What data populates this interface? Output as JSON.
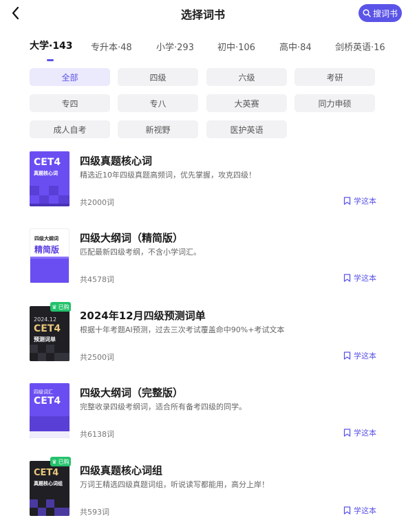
{
  "header": {
    "title": "选择词书",
    "search_label": "搜词书"
  },
  "tabs": [
    {
      "label": "大学·143",
      "active": true
    },
    {
      "label": "专升本·48",
      "active": false
    },
    {
      "label": "小学·293",
      "active": false
    },
    {
      "label": "初中·106",
      "active": false
    },
    {
      "label": "高中·84",
      "active": false
    },
    {
      "label": "剑桥英语·16",
      "active": false
    }
  ],
  "filters": [
    {
      "label": "全部",
      "active": true
    },
    {
      "label": "四级",
      "active": false
    },
    {
      "label": "六级",
      "active": false
    },
    {
      "label": "考研",
      "active": false
    },
    {
      "label": "专四",
      "active": false
    },
    {
      "label": "专八",
      "active": false
    },
    {
      "label": "大英赛",
      "active": false
    },
    {
      "label": "同力申硕",
      "active": false
    },
    {
      "label": "成人自考",
      "active": false
    },
    {
      "label": "新视野",
      "active": false
    },
    {
      "label": "医护英语",
      "active": false
    }
  ],
  "books": [
    {
      "title": "四级真题核心词",
      "desc": "精选近10年四级真题高频词，优先掌握，攻克四级！",
      "count": "共2000词",
      "action": "学这本",
      "bought": false,
      "cover": {
        "line1": "CET4",
        "line2": "真题核心词",
        "bg": "#6b4ef2",
        "style": "purple"
      }
    },
    {
      "title": "四级大纲词（精简版）",
      "desc": "匹配最新四级考纲，不含小学词汇。",
      "count": "共4578词",
      "action": "学这本",
      "bought": false,
      "cover": {
        "line1": "四级大纲词",
        "line2": "精简版",
        "bg": "#ffffff",
        "style": "white"
      }
    },
    {
      "title": "2024年12月四级预测词单",
      "desc": "根据十年考题AI预测，过去三次考试覆盖命中90%+考试文本",
      "count": "共2500词",
      "action": "学这本",
      "bought": true,
      "bought_label": "已购",
      "cover": {
        "line0": "2024.12",
        "line1": "CET4",
        "line2": "预测词单",
        "bg": "#1f1f24",
        "style": "dark"
      }
    },
    {
      "title": "四级大纲词（完整版）",
      "desc": "完整收录四级考纲词，适合所有备考四级的同学。",
      "count": "共6138词",
      "action": "学这本",
      "bought": false,
      "cover": {
        "line0": "四级词汇",
        "line1": "CET4",
        "bg": "#6b4ef2",
        "style": "purple2"
      }
    },
    {
      "title": "四级真题核心词组",
      "desc": "万词王精选四级真题词组，听说读写都能用，高分上岸！",
      "count": "共593词",
      "action": "学这本",
      "bought": true,
      "bought_label": "已购",
      "cover": {
        "line1": "CET4",
        "line2": "真题核心词组",
        "bg": "#1f1f24",
        "style": "dark2"
      }
    }
  ]
}
